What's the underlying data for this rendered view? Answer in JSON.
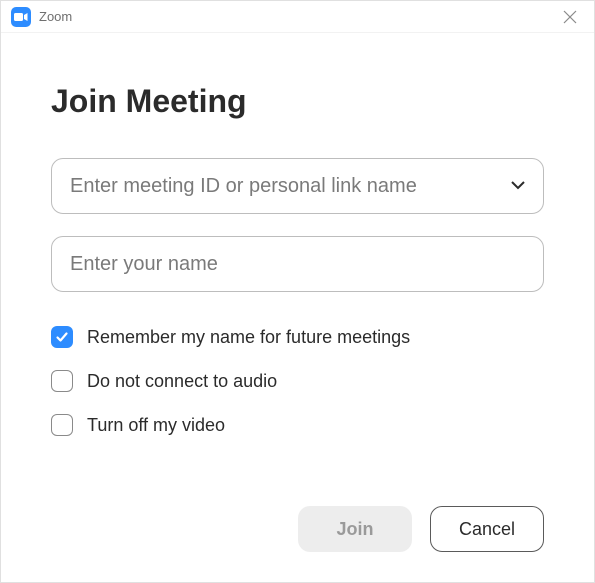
{
  "titlebar": {
    "app_name": "Zoom"
  },
  "dialog": {
    "heading": "Join Meeting",
    "meeting_id_placeholder": "Enter meeting ID or personal link name",
    "meeting_id_value": "",
    "name_placeholder": "Enter your name",
    "name_value": "",
    "checkboxes": {
      "remember": {
        "label": "Remember my name for future meetings",
        "checked": true
      },
      "no_audio": {
        "label": "Do not connect to audio",
        "checked": false
      },
      "no_video": {
        "label": "Turn off my video",
        "checked": false
      }
    },
    "buttons": {
      "join": "Join",
      "cancel": "Cancel"
    }
  },
  "colors": {
    "accent": "#2D8CFF"
  }
}
